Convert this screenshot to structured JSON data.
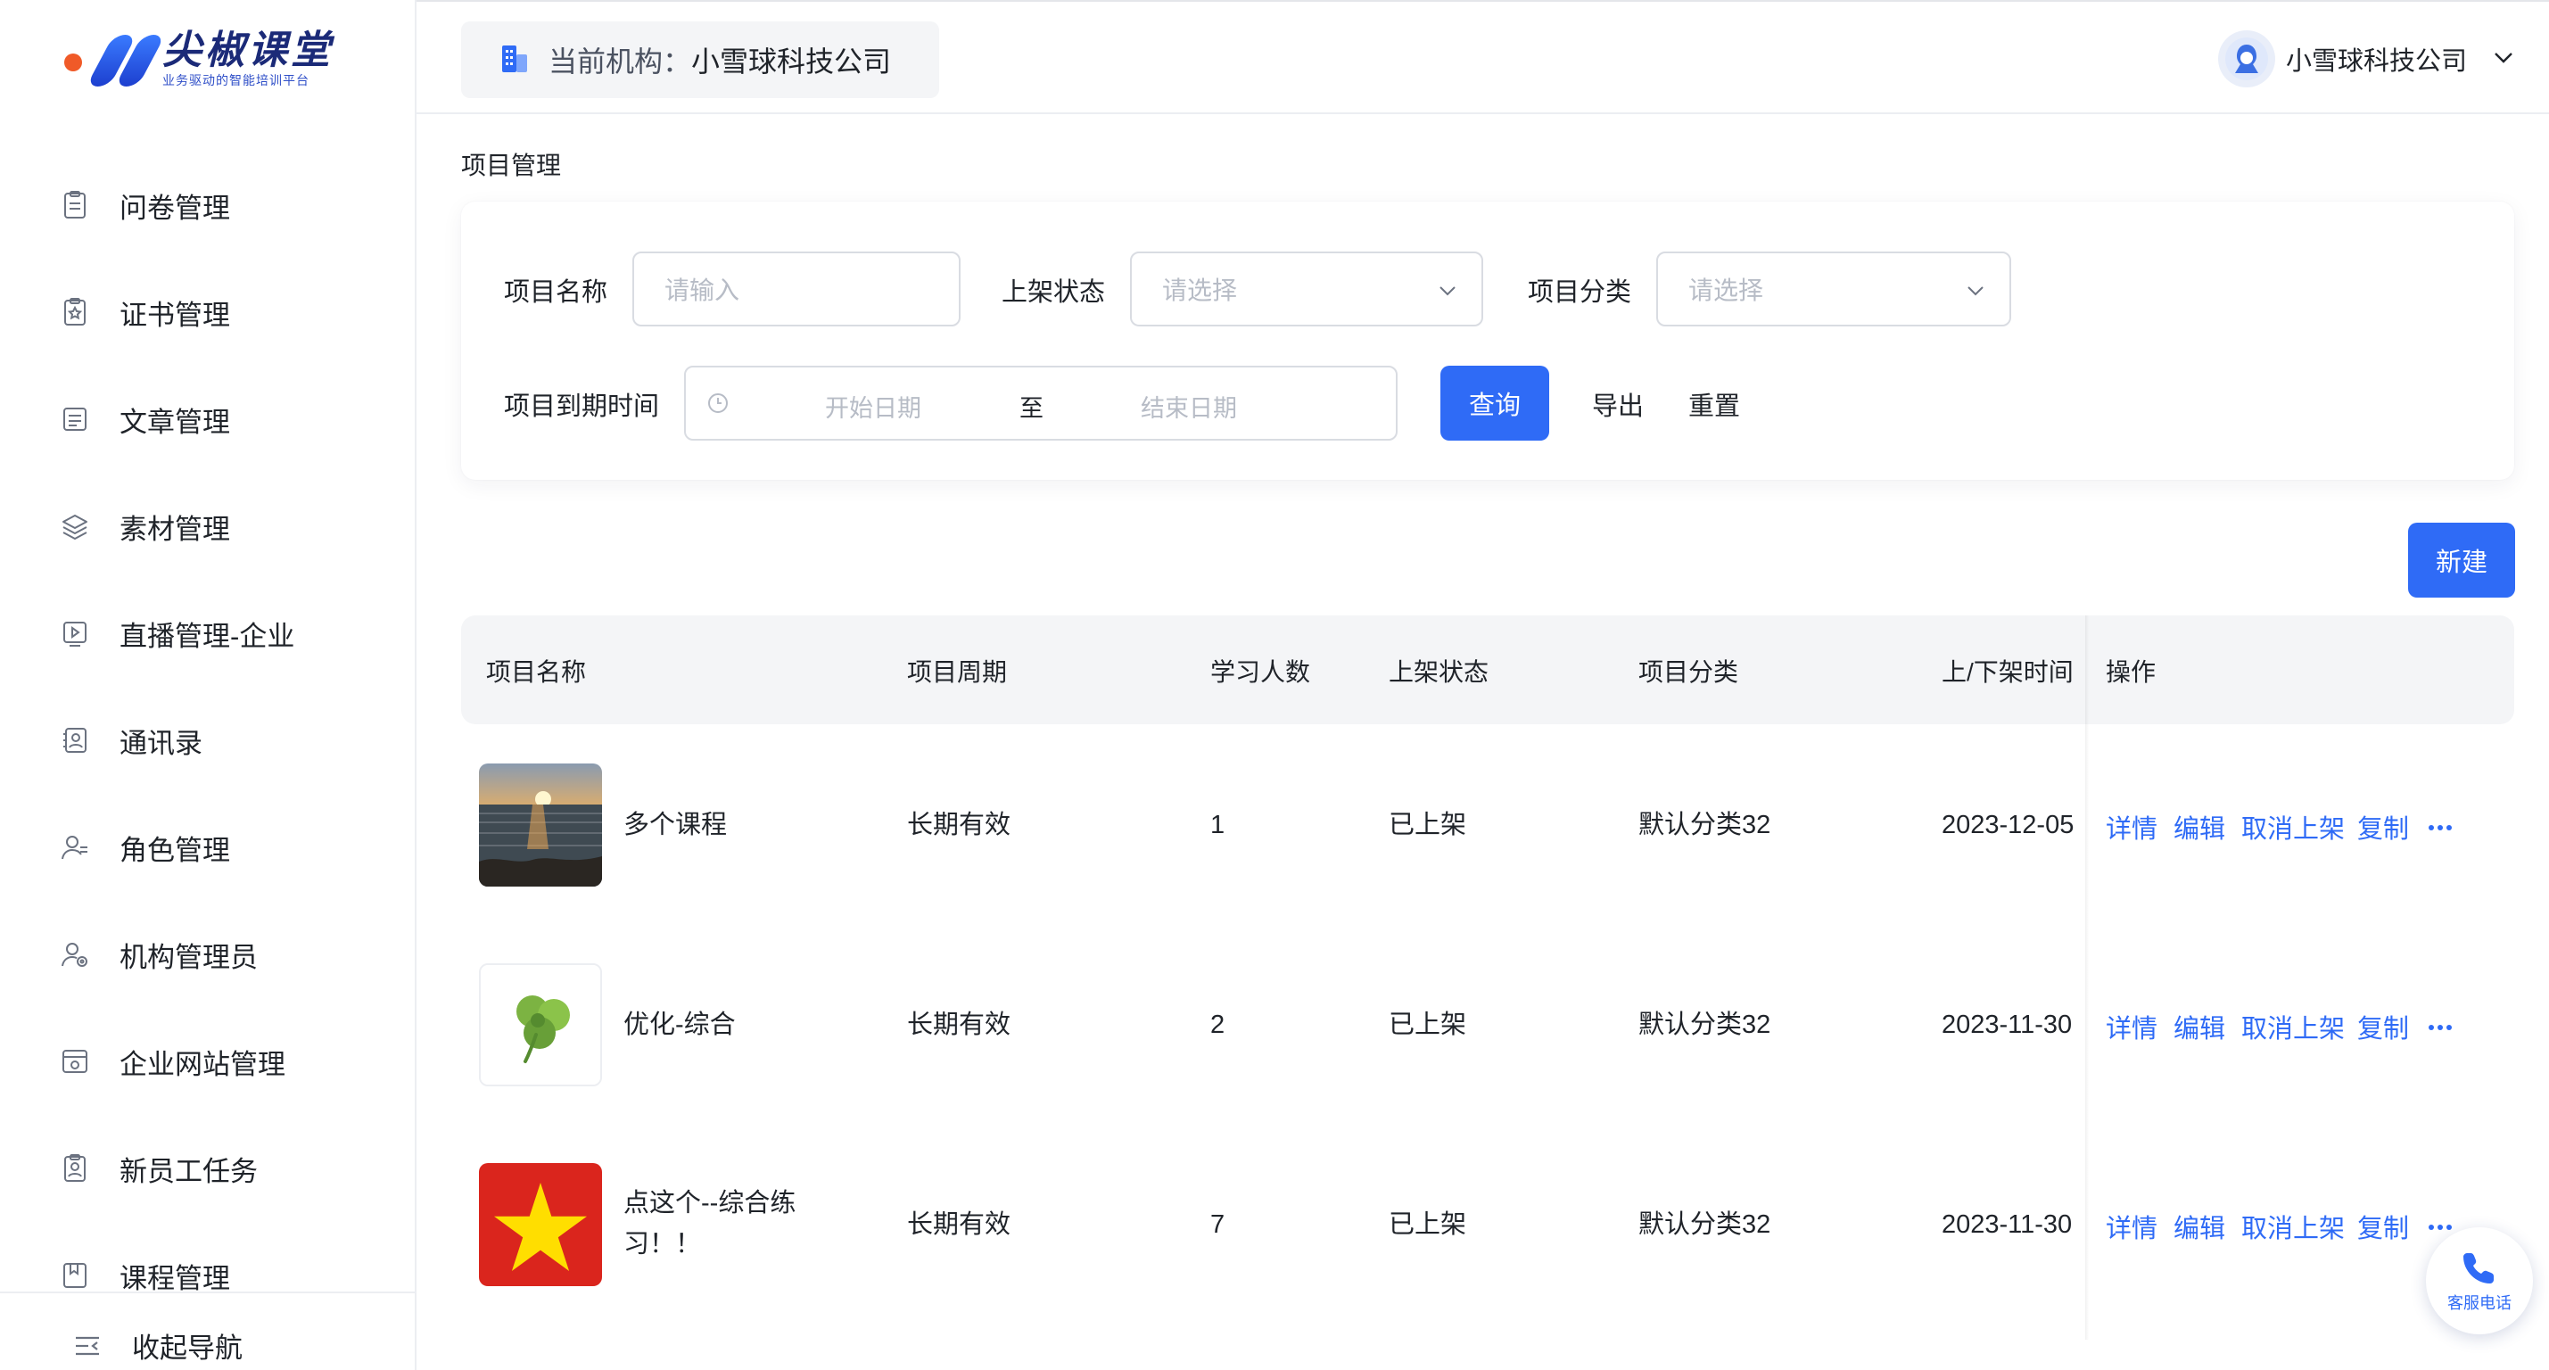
{
  "brand": {
    "name": "尖椒课堂",
    "tagline": "业务驱动的智能培训平台"
  },
  "sidebar": {
    "items": [
      {
        "label": "问卷管理",
        "icon": "questionnaire-icon"
      },
      {
        "label": "证书管理",
        "icon": "certificate-icon"
      },
      {
        "label": "文章管理",
        "icon": "article-icon"
      },
      {
        "label": "素材管理",
        "icon": "layers-icon"
      },
      {
        "label": "直播管理-企业",
        "icon": "live-play-icon"
      },
      {
        "label": "通讯录",
        "icon": "contacts-icon"
      },
      {
        "label": "角色管理",
        "icon": "role-icon"
      },
      {
        "label": "机构管理员",
        "icon": "admin-icon"
      },
      {
        "label": "企业网站管理",
        "icon": "website-icon"
      },
      {
        "label": "新员工任务",
        "icon": "new-employee-icon"
      },
      {
        "label": "课程管理",
        "icon": "course-icon"
      }
    ],
    "collapse_label": "收起导航"
  },
  "header": {
    "org_prefix": "当前机构：",
    "org_name": "小雪球科技公司",
    "user_name": "小雪球科技公司"
  },
  "breadcrumb": "项目管理",
  "filters": {
    "name_label": "项目名称",
    "name_placeholder": "请输入",
    "status_label": "上架状态",
    "status_placeholder": "请选择",
    "category_label": "项目分类",
    "category_placeholder": "请选择",
    "expiry_label": "项目到期时间",
    "start_placeholder": "开始日期",
    "range_sep": "至",
    "end_placeholder": "结束日期",
    "query_label": "查询",
    "export_label": "导出",
    "reset_label": "重置"
  },
  "new_button": "新建",
  "table": {
    "columns": [
      "项目名称",
      "项目周期",
      "学习人数",
      "上架状态",
      "项目分类",
      "上/下架时间",
      "操作"
    ],
    "rows": [
      {
        "thumb": "sunset-image",
        "name": "多个课程",
        "name_line2": "",
        "period": "长期有效",
        "learners": "1",
        "status": "已上架",
        "category": "默认分类32",
        "time": "2023-12-05"
      },
      {
        "thumb": "clover-image",
        "name": "优化-综合",
        "name_line2": "",
        "period": "长期有效",
        "learners": "2",
        "status": "已上架",
        "category": "默认分类32",
        "time": "2023-11-30"
      },
      {
        "thumb": "star-flag-image",
        "name": "点这个--综合练",
        "name_line2": "习！！",
        "period": "长期有效",
        "learners": "7",
        "status": "已上架",
        "category": "默认分类32",
        "time": "2023-11-30"
      }
    ],
    "actions": {
      "detail": "详情",
      "edit": "编辑",
      "unpublish": "取消上架",
      "copy": "复制"
    }
  },
  "service": {
    "label": "客服电话"
  },
  "colors": {
    "primary": "#2f6bf6",
    "brand_dark": "#1b2a78",
    "brand_dot": "#f05a28"
  }
}
